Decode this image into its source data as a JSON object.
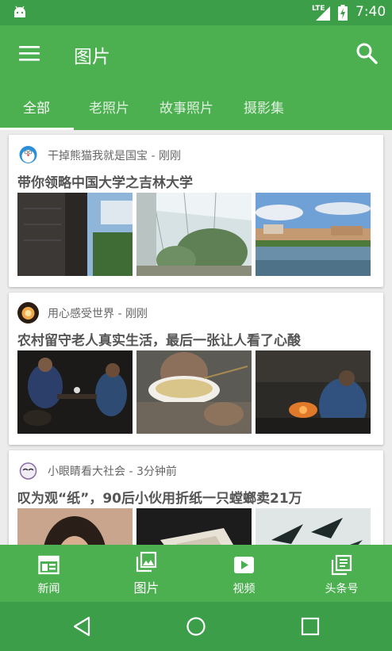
{
  "status_bar": {
    "network": "LTE",
    "time": "7:40",
    "icons": [
      "android-icon",
      "lte-signal-icon",
      "battery-charging-icon"
    ]
  },
  "app_bar": {
    "title": "图片",
    "menu_icon": "menu-icon",
    "search_icon": "search-icon"
  },
  "tabs": [
    {
      "label": "全部",
      "active": true
    },
    {
      "label": "老照片",
      "active": false
    },
    {
      "label": "故事照片",
      "active": false
    },
    {
      "label": "摄影集",
      "active": false
    }
  ],
  "feed": [
    {
      "author": "干掉熊猫我就是国宝",
      "time": "刚刚",
      "meta": "干掉熊猫我就是国宝 - 刚刚",
      "title": "带你领略中国大学之吉林大学",
      "image_count": 3
    },
    {
      "author": "用心感受世界",
      "time": "刚刚",
      "meta": "用心感受世界 - 刚刚",
      "title": "农村留守老人真实生活，最后一张让人看了心酸",
      "image_count": 3
    },
    {
      "author": "小眼睛看大社会",
      "time": "3分钟前",
      "meta": "小眼睛看大社会 - 3分钟前",
      "title": "叹为观“纸”，90后小伙用折纸一只螳螂卖21万",
      "image_count": 3
    }
  ],
  "bottom_nav": [
    {
      "label": "新闻",
      "icon": "news-icon",
      "active": false
    },
    {
      "label": "图片",
      "icon": "photo-library-icon",
      "active": true
    },
    {
      "label": "视频",
      "icon": "video-icon",
      "active": false
    },
    {
      "label": "头条号",
      "icon": "library-books-icon",
      "active": false
    }
  ],
  "colors": {
    "primary": "#4caf50",
    "primary_dark": "#3c9e48",
    "title_text": "#555555",
    "meta_text": "#666666"
  }
}
